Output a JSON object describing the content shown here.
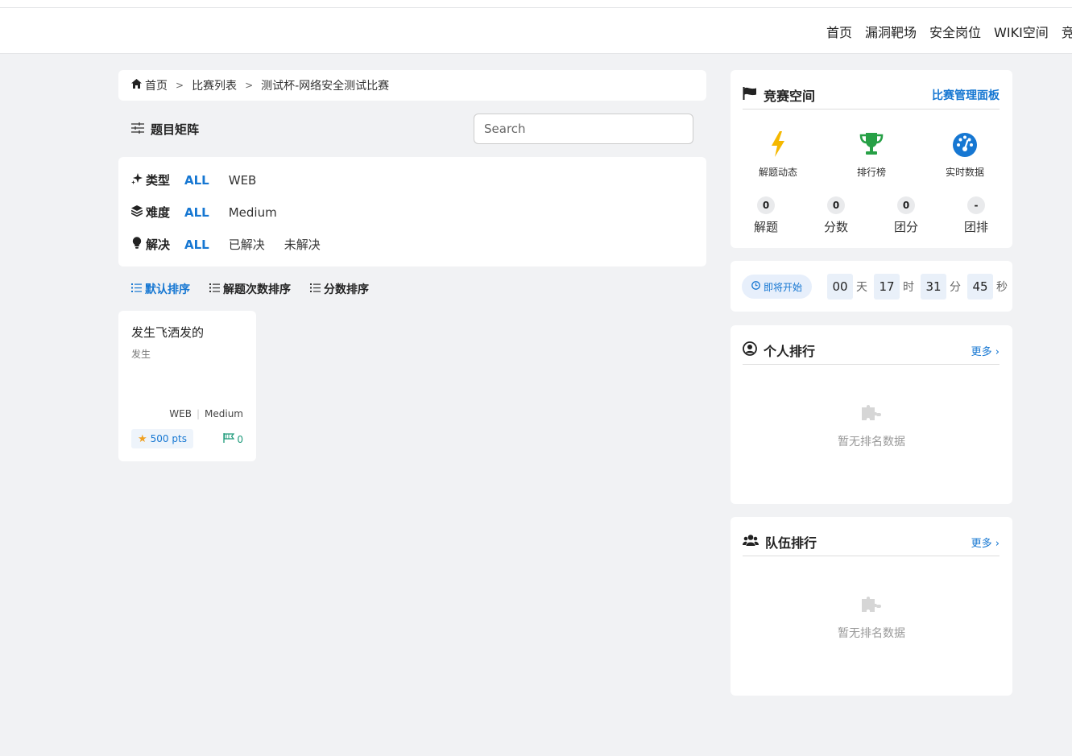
{
  "nav": {
    "items": [
      "首页",
      "漏洞靶场",
      "安全岗位",
      "WIKI空间",
      "竞赛"
    ]
  },
  "breadcrumb": {
    "items": [
      "首页",
      "比赛列表",
      "测试杯-网络安全测试比赛"
    ],
    "separator": ">"
  },
  "matrix": {
    "title": "题目矩阵",
    "search_placeholder": "Search"
  },
  "filters": {
    "type": {
      "label": "类型",
      "options": [
        "ALL",
        "WEB"
      ],
      "active": "ALL"
    },
    "difficulty": {
      "label": "难度",
      "options": [
        "ALL",
        "Medium"
      ],
      "active": "ALL"
    },
    "solved": {
      "label": "解决",
      "options": [
        "ALL",
        "已解决",
        "未解决"
      ],
      "active": "ALL"
    }
  },
  "sorts": {
    "default": "默认排序",
    "by_solves": "解题次数排序",
    "by_score": "分数排序",
    "active": "默认排序"
  },
  "challenge": {
    "title": "发生飞洒发的",
    "subtitle": "发生",
    "category": "WEB",
    "difficulty": "Medium",
    "points": "500 pts",
    "solves": "0"
  },
  "space": {
    "title": "竞赛空间",
    "admin_link": "比赛管理面板",
    "shortcuts": [
      "解题动态",
      "排行榜",
      "实时数据"
    ],
    "stats": [
      {
        "value": "0",
        "label": "解题"
      },
      {
        "value": "0",
        "label": "分数"
      },
      {
        "value": "0",
        "label": "团分"
      },
      {
        "value": "-",
        "label": "团排"
      }
    ]
  },
  "countdown": {
    "status": "即将开始",
    "days": "00",
    "days_unit": "天",
    "hours": "17",
    "hours_unit": "时",
    "minutes": "31",
    "minutes_unit": "分",
    "seconds": "45",
    "seconds_unit": "秒"
  },
  "personal_rank": {
    "title": "个人排行",
    "more": "更多",
    "empty": "暂无排名数据"
  },
  "team_rank": {
    "title": "队伍排行",
    "more": "更多",
    "empty": "暂无排名数据"
  },
  "colors": {
    "accent": "#1677d2",
    "background": "#f1f2f4",
    "bolt": "#f5b800",
    "trophy": "#27a046",
    "gauge": "#1677d2"
  }
}
